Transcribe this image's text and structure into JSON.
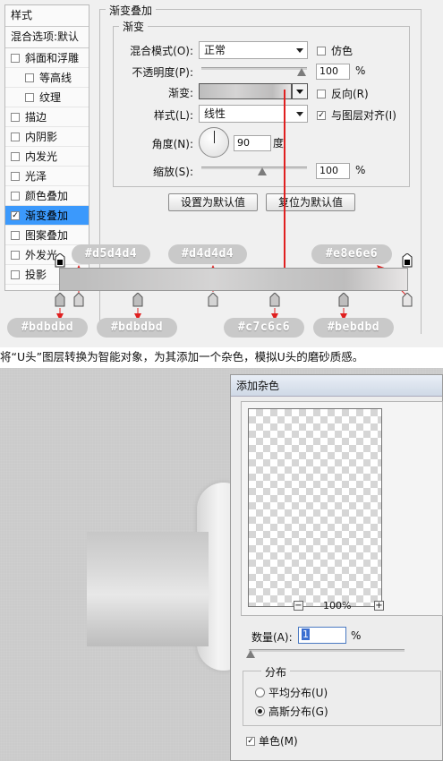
{
  "sidebar": {
    "header": "样式",
    "blend_options": "混合选项:默认",
    "items": [
      {
        "label": "斜面和浮雕",
        "checked": false,
        "indent": false
      },
      {
        "label": "等高线",
        "checked": false,
        "indent": true
      },
      {
        "label": "纹理",
        "checked": false,
        "indent": true
      },
      {
        "label": "描边",
        "checked": false,
        "indent": false
      },
      {
        "label": "内阴影",
        "checked": false,
        "indent": false
      },
      {
        "label": "内发光",
        "checked": false,
        "indent": false
      },
      {
        "label": "光泽",
        "checked": false,
        "indent": false
      },
      {
        "label": "颜色叠加",
        "checked": false,
        "indent": false
      },
      {
        "label": "渐变叠加",
        "checked": true,
        "indent": false,
        "selected": true
      },
      {
        "label": "图案叠加",
        "checked": false,
        "indent": false
      },
      {
        "label": "外发光",
        "checked": false,
        "indent": false
      },
      {
        "label": "投影",
        "checked": false,
        "indent": false
      }
    ]
  },
  "gradient_overlay": {
    "section_title": "渐变叠加",
    "group_title": "渐变",
    "blend_mode_label": "混合模式(O):",
    "blend_mode_value": "正常",
    "dither_label": "仿色",
    "opacity_label": "不透明度(P):",
    "opacity_value": "100",
    "opacity_unit": "%",
    "opacity_level": 1.0,
    "gradient_label": "渐变:",
    "reverse_label": "反向(R)",
    "style_label": "样式(L):",
    "style_value": "线性",
    "align_label": "与图层对齐(I)",
    "align_checked": true,
    "angle_label": "角度(N):",
    "angle_value": "90",
    "angle_unit": "度",
    "scale_label": "缩放(S):",
    "scale_value": "100",
    "scale_unit": "%",
    "scale_level": 0.5,
    "make_default_button": "设置为默认值",
    "reset_default_button": "复位为默认值"
  },
  "gradient_stops": {
    "top_labels": [
      "#d5d4d4",
      "#d4d4d4",
      "#e8e6e6"
    ],
    "bottom_labels": [
      "#bdbdbd",
      "#bdbdbd",
      "#c7c6c6",
      "#bebdbd"
    ]
  },
  "caption": "将“U头”图层转换为智能对象，为其添加一个杂色，模拟U头的磨砂质感。",
  "noise_dialog": {
    "title": "添加杂色",
    "zoom_value": "100%",
    "zoom_minus": "−",
    "zoom_plus": "+",
    "amount_label": "数量(A):",
    "amount_value": "1",
    "amount_unit": "%",
    "distribution_title": "分布",
    "uniform_label": "平均分布(U)",
    "gaussian_label": "高斯分布(G)",
    "gaussian_selected": true,
    "mono_label": "单色(M)",
    "mono_checked": true
  },
  "colors": {
    "arrow_red": "#e02020",
    "selection_blue": "#3b99fc",
    "pill_gray": "#c9c9c9"
  }
}
